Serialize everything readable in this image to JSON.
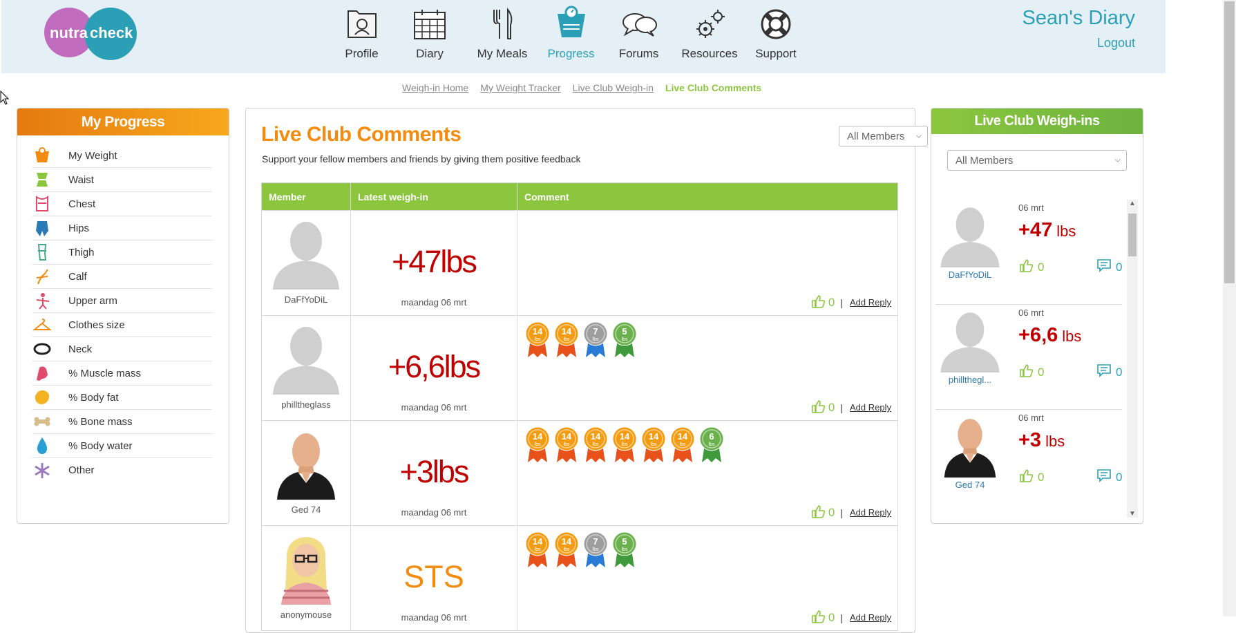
{
  "header": {
    "logo_text_left": "nutra",
    "logo_text_right": "check",
    "diary_title": "Sean's Diary",
    "logout_label": "Logout",
    "nav": [
      {
        "label": "Profile",
        "icon": "profile-icon"
      },
      {
        "label": "Diary",
        "icon": "calendar-icon"
      },
      {
        "label": "My Meals",
        "icon": "fork-knife-icon"
      },
      {
        "label": "Progress",
        "icon": "scale-icon",
        "active": true
      },
      {
        "label": "Forums",
        "icon": "chat-bubbles-icon"
      },
      {
        "label": "Resources",
        "icon": "gears-icon"
      },
      {
        "label": "Support",
        "icon": "lifebuoy-icon"
      }
    ]
  },
  "subnav": {
    "items": [
      "Weigh-in Home",
      "My Weight Tracker",
      "Live Club Weigh-in",
      "Live Club Comments"
    ],
    "current": "Live Club Comments"
  },
  "left_panel": {
    "title": "My Progress",
    "items": [
      {
        "label": "My Weight",
        "icon": "weight-scale-icon"
      },
      {
        "label": "Waist",
        "icon": "waist-icon"
      },
      {
        "label": "Chest",
        "icon": "chest-icon"
      },
      {
        "label": "Hips",
        "icon": "hips-icon"
      },
      {
        "label": "Thigh",
        "icon": "thigh-icon"
      },
      {
        "label": "Calf",
        "icon": "calf-icon"
      },
      {
        "label": "Upper arm",
        "icon": "upper-arm-icon"
      },
      {
        "label": "Clothes size",
        "icon": "hanger-icon"
      },
      {
        "label": "Neck",
        "icon": "neck-icon"
      },
      {
        "label": "% Muscle mass",
        "icon": "muscle-icon"
      },
      {
        "label": "% Body fat",
        "icon": "body-fat-icon"
      },
      {
        "label": "% Bone mass",
        "icon": "bone-icon"
      },
      {
        "label": "% Body water",
        "icon": "water-drop-icon"
      },
      {
        "label": "Other",
        "icon": "asterisk-icon"
      }
    ]
  },
  "center": {
    "title": "Live Club Comments",
    "subtitle": "Support your fellow members and friends by giving them positive feedback",
    "filter_value": "All Members",
    "columns": [
      "Member",
      "Latest weigh-in",
      "Comment"
    ],
    "add_reply_label": "Add Reply",
    "rows": [
      {
        "member": "DaFfYoDiL",
        "avatar": "default",
        "weighin": "+47lbs",
        "date": "maandag 06 mrt",
        "likes": "0",
        "medals": []
      },
      {
        "member": "philltheglass",
        "avatar": "default",
        "weighin": "+6,6lbs",
        "date": "maandag 06 mrt",
        "likes": "0",
        "medals": [
          {
            "text": "14",
            "sub": "lbs",
            "color": "#f39c12"
          },
          {
            "text": "14",
            "sub": "lbs",
            "color": "#f39c12"
          },
          {
            "text": "7",
            "sub": "lbs",
            "color": "#9e9e9e"
          },
          {
            "text": "5",
            "sub": "lbs",
            "color": "#6ab04c"
          }
        ]
      },
      {
        "member": "Ged 74",
        "avatar": "man",
        "weighin": "+3lbs",
        "date": "maandag 06 mrt",
        "likes": "0",
        "medals": [
          {
            "text": "14",
            "sub": "lbs",
            "color": "#f39c12"
          },
          {
            "text": "14",
            "sub": "lbs",
            "color": "#f39c12"
          },
          {
            "text": "14",
            "sub": "lbs",
            "color": "#f39c12"
          },
          {
            "text": "14",
            "sub": "lbs",
            "color": "#f39c12"
          },
          {
            "text": "14",
            "sub": "lbs",
            "color": "#f39c12"
          },
          {
            "text": "14",
            "sub": "lbs",
            "color": "#f39c12"
          },
          {
            "text": "6",
            "sub": "lbs",
            "color": "#6ab04c"
          }
        ]
      },
      {
        "member": "anonymouse",
        "avatar": "woman",
        "weighin": "STS",
        "date": "maandag 06 mrt",
        "likes": "0",
        "medals": [
          {
            "text": "14",
            "sub": "lbs",
            "color": "#f39c12"
          },
          {
            "text": "14",
            "sub": "lbs",
            "color": "#f39c12"
          },
          {
            "text": "7",
            "sub": "lbs",
            "color": "#9e9e9e"
          },
          {
            "text": "5",
            "sub": "lbs",
            "color": "#6ab04c"
          }
        ]
      }
    ]
  },
  "right_panel": {
    "title": "Live Club Weigh-ins",
    "filter_value": "All Members",
    "items": [
      {
        "name": "DaFfYoDiL",
        "avatar": "default",
        "date": "06 mrt",
        "value": "+47",
        "unit": "lbs",
        "likes": "0",
        "comments": "0"
      },
      {
        "name": "phillthegl...",
        "avatar": "default",
        "date": "06 mrt",
        "value": "+6,6",
        "unit": "lbs",
        "likes": "0",
        "comments": "0"
      },
      {
        "name": "Ged 74",
        "avatar": "man",
        "date": "06 mrt",
        "value": "+3",
        "unit": "lbs",
        "likes": "0",
        "comments": "0"
      }
    ]
  },
  "colors": {
    "accent_teal": "#2a9fb6",
    "accent_orange": "#f28c10",
    "accent_green": "#8cc63f",
    "weight_red": "#c00000"
  }
}
